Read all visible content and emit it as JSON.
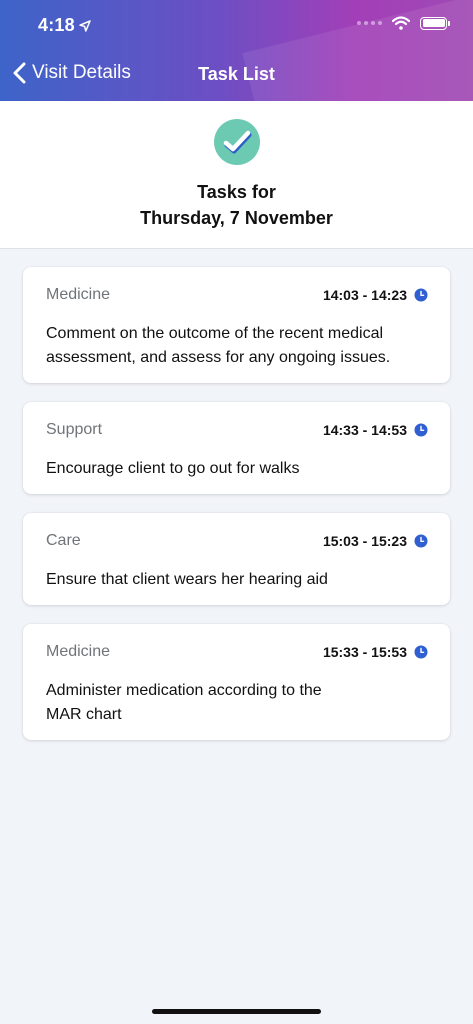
{
  "status_bar": {
    "time": "4:18"
  },
  "nav": {
    "back_label": "Visit Details",
    "title": "Task List"
  },
  "header": {
    "tasks_for": "Tasks for",
    "date": "Thursday, 7 November"
  },
  "tasks": [
    {
      "category": "Medicine",
      "time": "14:03 - 14:23",
      "description": "Comment on the outcome of the recent medical assessment, and assess for any ongoing issues."
    },
    {
      "category": "Support",
      "time": "14:33 - 14:53",
      "description": "Encourage client to go out for walks"
    },
    {
      "category": "Care",
      "time": "15:03 - 15:23",
      "description": "Ensure that client wears her hearing aid"
    },
    {
      "category": "Medicine",
      "time": "15:33 - 15:53",
      "description": "Administer medication according to the MAR chart"
    }
  ],
  "colors": {
    "nav_gradient_start": "#3d64c9",
    "nav_gradient_end": "#a04ab4",
    "check_badge": "#6ccab3",
    "clock_icon": "#2f5fd0",
    "background": "#f1f4f9"
  },
  "icons": [
    "location-arrow-icon",
    "cellular-signal-icon",
    "wifi-icon",
    "battery-icon",
    "chevron-left-icon",
    "checkmark-icon",
    "clock-icon"
  ]
}
